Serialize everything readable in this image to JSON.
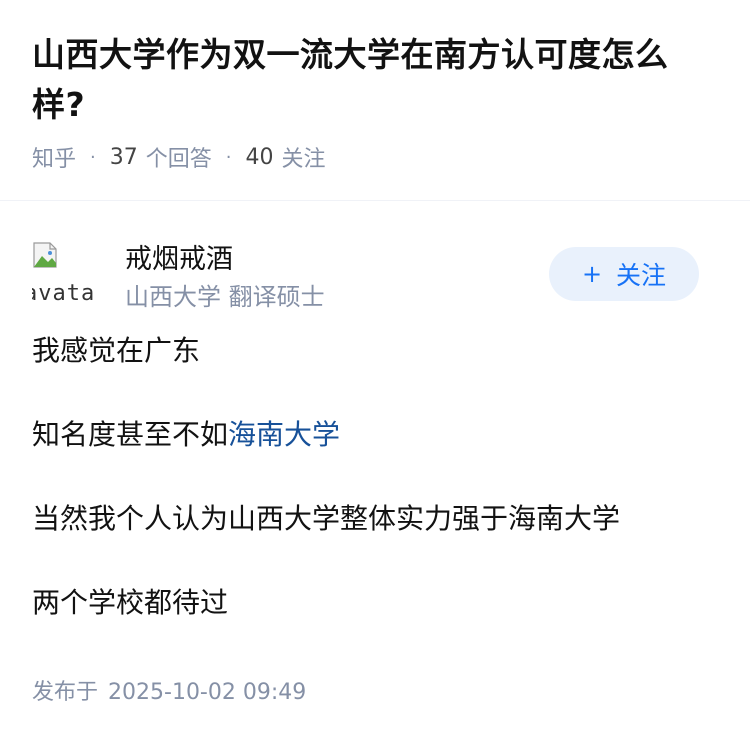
{
  "question": {
    "title": "山西大学作为双一流大学在南方认可度怎么样?",
    "source": "知乎",
    "answers_count": "37",
    "answers_label": "个回答",
    "followers_count": "40",
    "followers_label": "关注"
  },
  "answer": {
    "author": {
      "avatar_alt": "avatar",
      "name": "戒烟戒酒",
      "bio": "山西大学 翻译硕士",
      "follow_label": "关注",
      "follow_icon": "plus-icon"
    },
    "paragraphs": [
      {
        "text": "我感觉在广东"
      },
      {
        "prefix": "知名度甚至不如",
        "link": "海南大学"
      },
      {
        "text": "当然我个人认为山西大学整体实力强于海南大学"
      },
      {
        "text": "两个学校都待过"
      }
    ],
    "publish_label": "发布于",
    "publish_time": "2025-10-02 09:49"
  },
  "colors": {
    "link": "#175199",
    "meta": "#8590a6",
    "follow_text": "#1772f6",
    "follow_bg": "#e9f1fc"
  }
}
